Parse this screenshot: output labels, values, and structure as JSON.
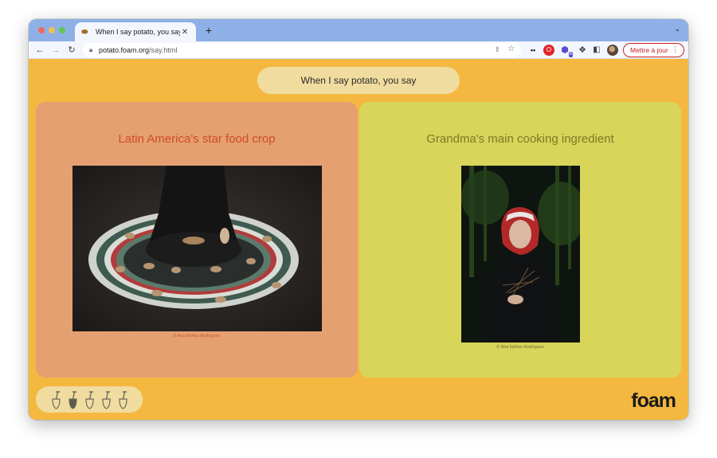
{
  "browser": {
    "tab": {
      "title": "When I say potato, you say",
      "favicon": "potato-icon"
    },
    "url": {
      "host": "potato.foam.org",
      "path": "/say.html"
    },
    "update_button": "Mettre à jour"
  },
  "page": {
    "question": "When I say potato, you say",
    "cards": [
      {
        "title": "Latin America's star food crop",
        "caption": "© Ana Núñez Rodríguez"
      },
      {
        "title": "Grandma's main cooking ingredient",
        "caption": "© Ana Núñez Rodríguez"
      }
    ],
    "progress": {
      "total": 5,
      "current": 2
    },
    "logo": "foam"
  },
  "colors": {
    "page_bg": "#f4b840",
    "left_card": "#e4a070",
    "right_card": "#d9d45a",
    "left_title": "#d14b24",
    "right_title": "#7b7b28",
    "pill": "#f0dc9e"
  }
}
